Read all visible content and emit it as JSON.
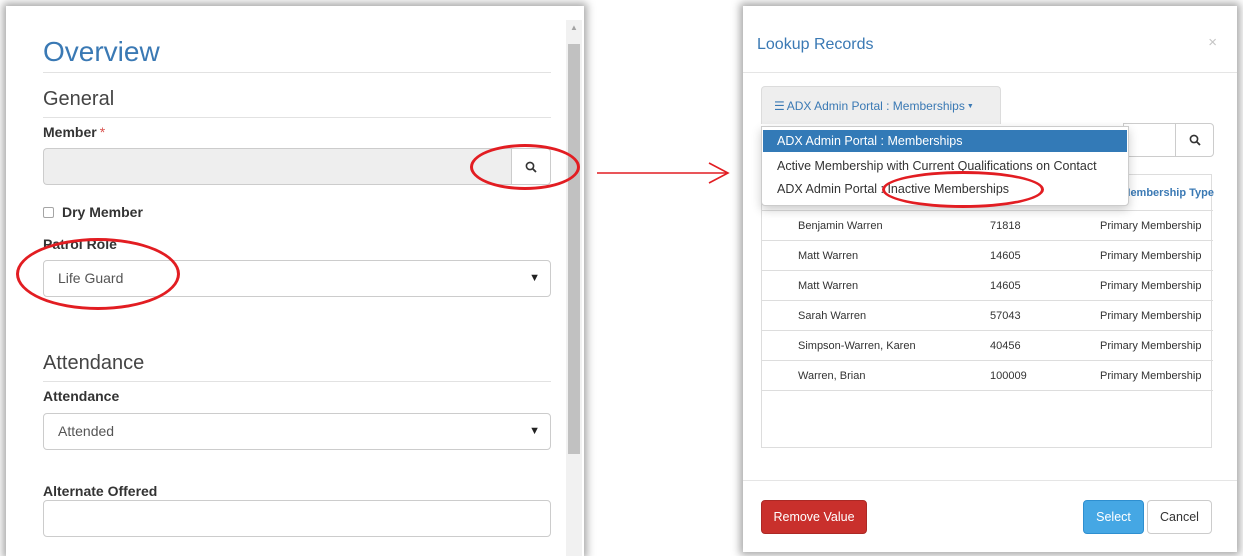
{
  "form": {
    "title": "Overview",
    "general_section": "General",
    "member_label": "Member",
    "member_required_mark": "*",
    "member_value": "",
    "dry_member_label": "Dry Member",
    "dry_member_checked": false,
    "patrol_role_label": "Patrol Role",
    "patrol_role_value": "Life Guard",
    "attendance_section": "Attendance",
    "attendance_label": "Attendance",
    "attendance_value": "Attended",
    "alternate_offered_label": "Alternate Offered",
    "alternate_offered_value": ""
  },
  "modal": {
    "title": "Lookup Records",
    "close": "×",
    "views_button": "ADX Admin Portal : Memberships",
    "views": [
      {
        "label": "ADX Admin Portal : Memberships",
        "active": true
      },
      {
        "label": "Active Membership with Current Qualifications on Contact",
        "active": false
      },
      {
        "label": "ADX Admin Portal : Inactive Memberships",
        "active": false
      }
    ],
    "search_value": "",
    "grid": {
      "type_header": "Membership Type",
      "rows": [
        {
          "name": "Benjamin Warren",
          "number": "71818",
          "type": "Primary Membership"
        },
        {
          "name": "Matt Warren",
          "number": "14605",
          "type": "Primary Membership"
        },
        {
          "name": "Matt Warren",
          "number": "14605",
          "type": "Primary Membership"
        },
        {
          "name": "Sarah Warren",
          "number": "57043",
          "type": "Primary Membership"
        },
        {
          "name": "Simpson-Warren, Karen",
          "number": "40456",
          "type": "Primary Membership"
        },
        {
          "name": "Warren, Brian",
          "number": "100009",
          "type": "Primary Membership"
        }
      ]
    },
    "remove_button": "Remove Value",
    "select_button": "Select",
    "cancel_button": "Cancel"
  },
  "colors": {
    "link_blue": "#3a79b4",
    "annotation_red": "#e21d22",
    "danger": "#c9302c",
    "primary": "#45a7e4",
    "active_item": "#337ab7"
  }
}
